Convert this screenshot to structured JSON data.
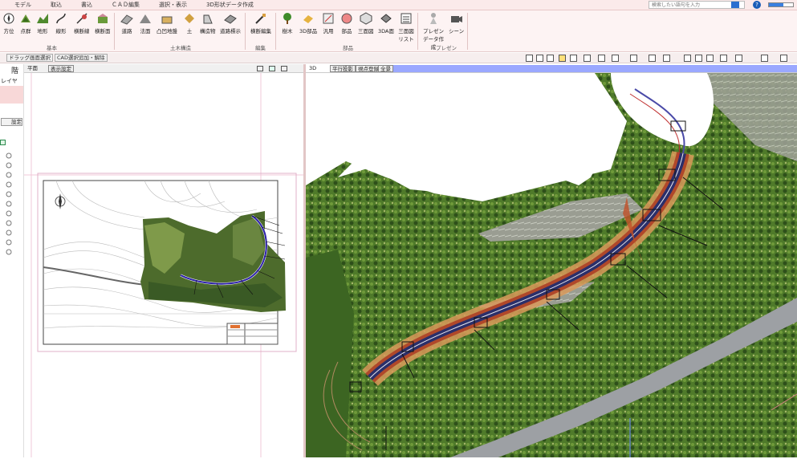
{
  "menu": [
    "モデル",
    "取込",
    "書込",
    "ＣＡＤ編集",
    "選択・表示",
    "3D形状データ作成"
  ],
  "search": {
    "placeholder": "検索したい語句を入力"
  },
  "progress_percent": 60,
  "ribbon": {
    "buttons": [
      {
        "label": "方位"
      },
      {
        "label": "点群"
      },
      {
        "label": "地形"
      },
      {
        "label": "線形"
      },
      {
        "label": "横断線"
      },
      {
        "label": "横断面"
      },
      {
        "label": "道路"
      },
      {
        "label": "法面"
      },
      {
        "label": "凸凹地盤"
      },
      {
        "label": "土"
      },
      {
        "label": "構造物"
      },
      {
        "label": "道路標示"
      },
      {
        "label": "横断編集"
      },
      {
        "label": "樹木"
      },
      {
        "label": "3D部品"
      },
      {
        "label": "汎用"
      },
      {
        "label": "部品"
      },
      {
        "label": "三面図"
      },
      {
        "label": "3DA面"
      },
      {
        "label": "三面図リスト"
      },
      {
        "label": "プレゼンデータ作成"
      },
      {
        "label": "シーン"
      }
    ],
    "groups": [
      "基本",
      "土木構造",
      "編集",
      "部品",
      "プレゼン"
    ]
  },
  "toolbar2": {
    "buttons": [
      "ドラッグ画面選択",
      "CAD選択追加・解除"
    ]
  },
  "left_panel": {
    "title": "階",
    "layer_label": "レイヤ",
    "setting": "設定"
  },
  "plan": {
    "tab_plan": "平面",
    "tab_display": "表示設定"
  },
  "view3d": {
    "tab_3d": "3D",
    "tab_parallel": "平行投影",
    "tab_display": "視点登録",
    "tab_all": "全景"
  }
}
